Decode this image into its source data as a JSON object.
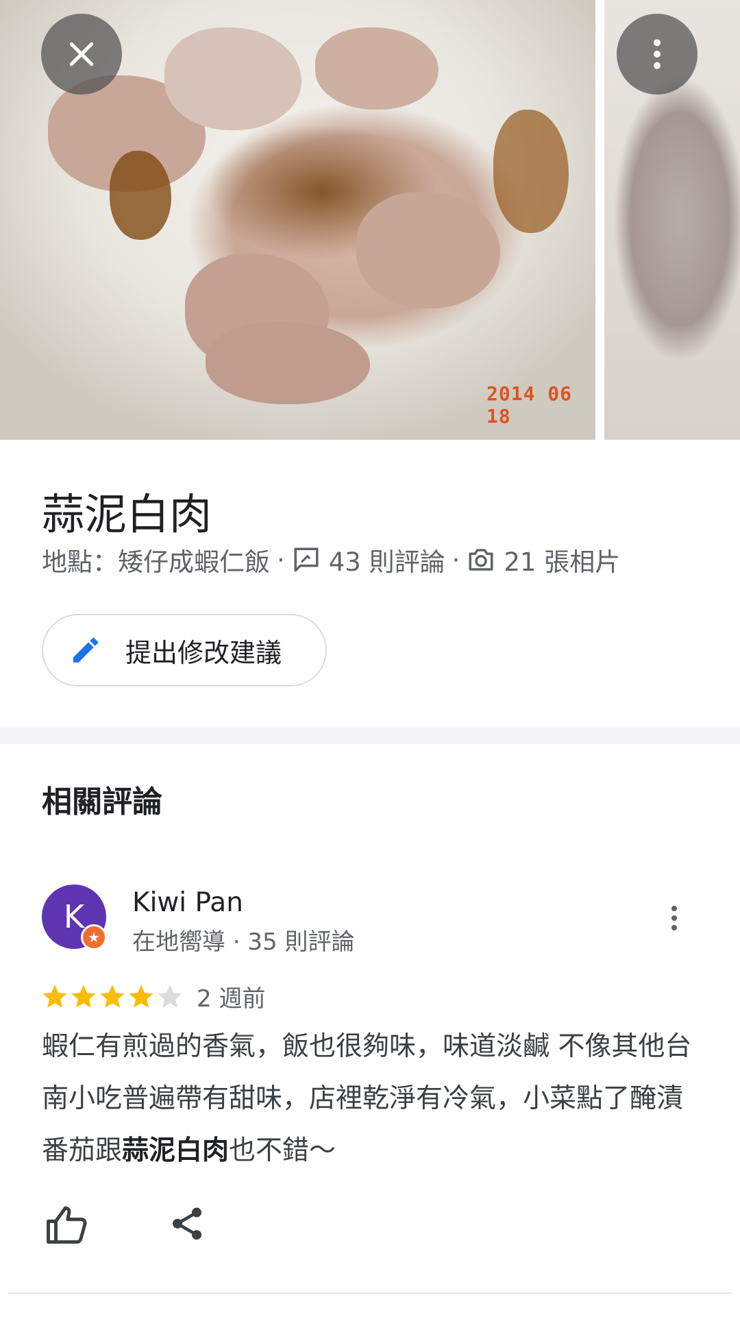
{
  "photos": {
    "main_date_stamp": "2014 06 18"
  },
  "toolbar": {
    "close_icon": "close-icon",
    "more_icon": "more-vert-icon"
  },
  "dish": {
    "title": "蒜泥白肉",
    "location": "地點：矮仔成蝦仁飯",
    "reviews_count": "43 則評論",
    "photos_count": "21 張相片",
    "suggest_label": "提出修改建議"
  },
  "reviews_section": {
    "title": "相關評論",
    "items": [
      {
        "avatar_letter": "K",
        "name": "Kiwi Pan",
        "meta": "在地嚮導 · 35 則評論",
        "rating": 4,
        "max_rating": 5,
        "time": "2 週前",
        "text_before": "蝦仁有煎過的香氣，飯也很夠味，味道淡鹹 不像其他台南小吃普遍帶有甜味，店裡乾淨有冷氣，小菜點了醃漬番茄跟",
        "text_highlight": "蒜泥白肉",
        "text_after": "也不錯～"
      }
    ]
  },
  "colors": {
    "avatar": "#5e35b1",
    "badge": "#ee6f2d",
    "star_filled": "#fbbc04",
    "star_empty": "#dadce0",
    "accent_blue": "#1a73e8"
  }
}
